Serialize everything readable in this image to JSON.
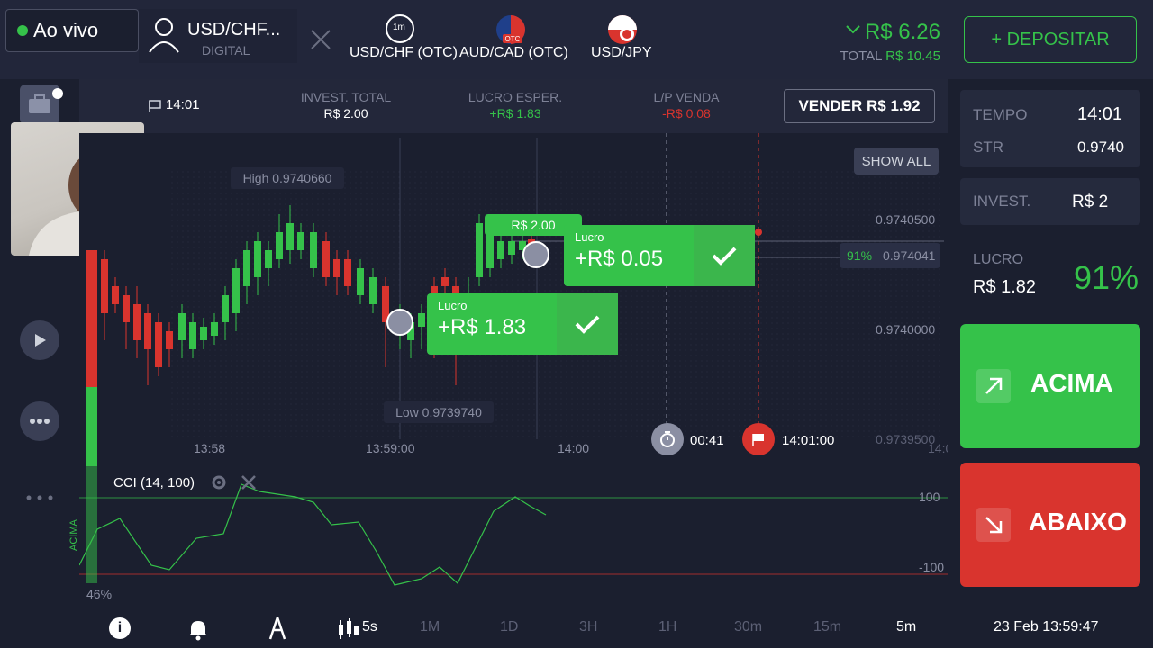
{
  "topbar": {
    "live_label": "Ao vivo",
    "tabs": [
      {
        "label": "USD/CHF...",
        "sublabel": "DIGITAL",
        "badge": "1",
        "icon_text": "1m"
      },
      {
        "label": "USD/CHF (OTC)",
        "icon_text": "1m"
      },
      {
        "label": "AUD/CAD (OTC)",
        "icon_text": "OTC"
      },
      {
        "label": "USD/JPY"
      }
    ],
    "balance": "R$ 6.26",
    "total_label": "TOTAL",
    "total_value": "R$ 10.45",
    "deposit_label": "+ DEPOSITAR"
  },
  "infobar": {
    "expiry": "14:01",
    "invest_label": "INVEST. TOTAL",
    "invest_value": "R$ 2.00",
    "profit_label": "LUCRO ESPER.",
    "profit_value": "+R$ 1.83",
    "pl_label": "L/P VENDA",
    "pl_value": "-R$ 0.08",
    "sell_label": "VENDER R$ 1.92"
  },
  "chart": {
    "show_all": "SHOW ALL",
    "high_label": "High 0.9740660",
    "low_label": "Low 0.9739740",
    "price_levels": [
      "0.9740500",
      "0.9740000",
      "0.9739500"
    ],
    "current_percent": "91%",
    "current_price": "0.974041",
    "time_labels": [
      "13:58",
      "13:59:00",
      "14:00"
    ],
    "timer": "00:41",
    "expiry_time": "14:01:00",
    "edge_time": "14:0",
    "popup_invest": "R$ 2.00",
    "popup_1_label": "Lucro",
    "popup_1_value": "+R$ 0.05",
    "popup_2_label": "Lucro",
    "popup_2_value": "+R$ 1.83",
    "side_percent": "46%",
    "side_acima": "ACIMA"
  },
  "cci": {
    "label": "CCI (14, 100)",
    "level_top": "100",
    "level_bottom": "-100"
  },
  "rightpanel": {
    "time_label": "TEMPO",
    "time_value": "14:01",
    "str_label": "STR",
    "str_value": "0.9740",
    "invest_label": "INVEST.",
    "invest_value": "R$ 2",
    "profit_label": "LUCRO",
    "profit_value": "R$ 1.82",
    "profit_percent": "91%",
    "up_label": "ACIMA",
    "down_label": "ABAIXO"
  },
  "bottombar": {
    "timeframes": [
      "5s",
      "1M",
      "1D",
      "3H",
      "1H",
      "30m",
      "15m",
      "5m"
    ],
    "datetime": "23 Feb 13:59:47"
  },
  "colors": {
    "bg": "#1b1f2f",
    "green": "#35c24a",
    "red": "#d9342e"
  }
}
